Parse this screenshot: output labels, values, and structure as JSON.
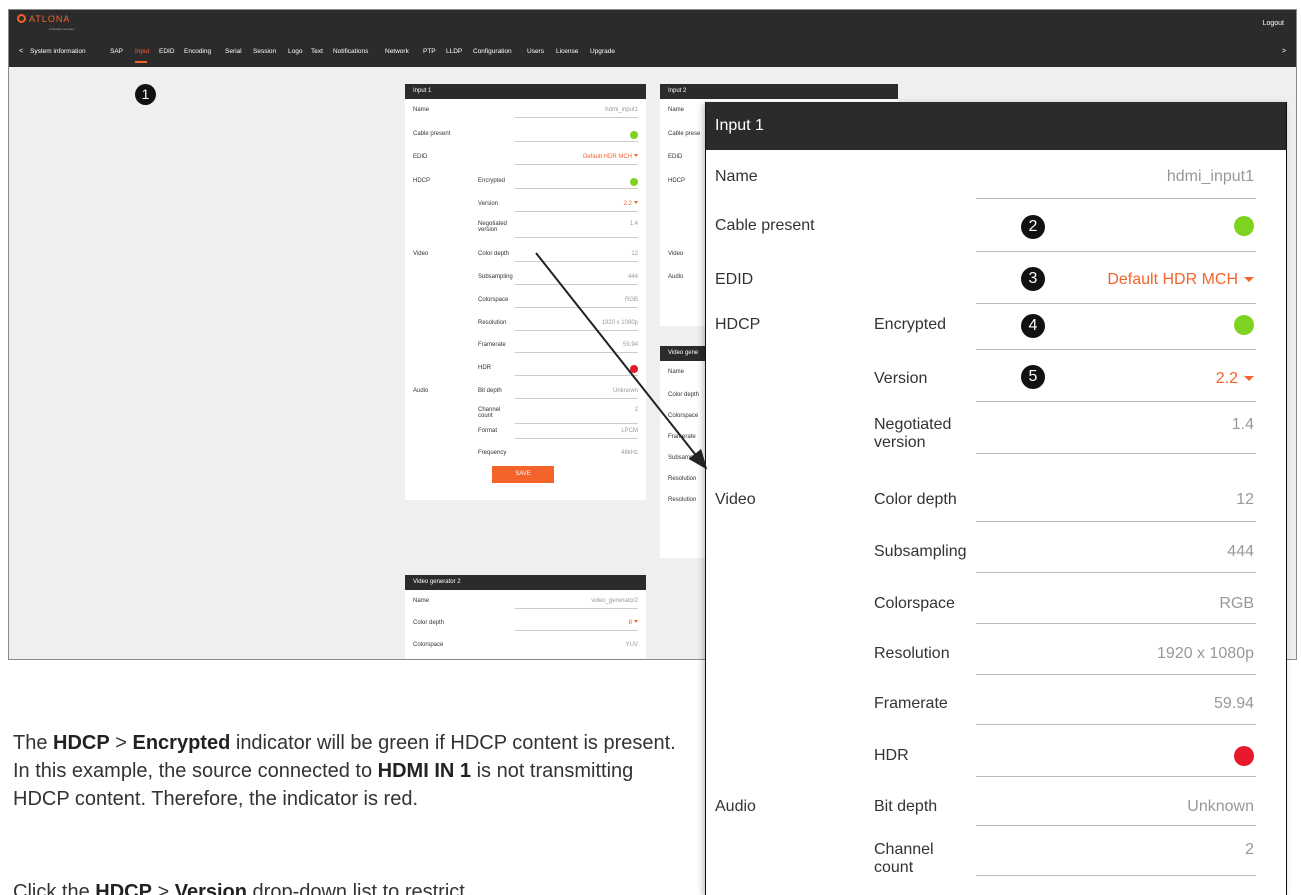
{
  "app": {
    "logo": "ATLONA",
    "logo_sub": "a Panduit company",
    "logout": "Logout",
    "nav_left": "<",
    "nav_right": ">",
    "nav_items": [
      "System information",
      "SAP",
      "Input",
      "EDID",
      "Encoding",
      "Serial",
      "Session",
      "Logo",
      "Text",
      "Notifications",
      "Network",
      "PTP",
      "LLDP",
      "Configuration",
      "Users",
      "License",
      "Upgrade"
    ],
    "active_tab": "Input",
    "marker": "1"
  },
  "input1": {
    "title": "Input 1",
    "name_label": "Name",
    "name_value": "hdmi_input1",
    "cable_label": "Cable present",
    "edid_label": "EDID",
    "edid_value": "Default HDR MCH",
    "hdcp_label": "HDCP",
    "encrypted_label": "Encrypted",
    "version_label": "Version",
    "version_value": "2.2",
    "negotiated_label": "Negotiated version",
    "negotiated_value": "1.4",
    "video_label": "Video",
    "color_depth_label": "Color depth",
    "color_depth_value": "12",
    "subsampling_label": "Subsampling",
    "subsampling_value": "444",
    "colorspace_label": "Colorspace",
    "colorspace_value": "RGB",
    "resolution_label": "Resolution",
    "resolution_value": "1920 x 1080p",
    "framerate_label": "Framerate",
    "framerate_value": "59.94",
    "hdr_label": "HDR",
    "audio_label": "Audio",
    "bit_depth_label": "Bit depth",
    "bit_depth_value": "Unknown",
    "channel_label": "Channel count",
    "channel_value": "2",
    "format_label": "Format",
    "format_value": "LPCM",
    "frequency_label": "Frequency",
    "frequency_value": "48kHz",
    "save": "SAVE"
  },
  "input2": {
    "title": "Input 2",
    "rows": [
      "Name",
      "Cable prese",
      "EDID",
      "HDCP",
      "Video",
      "Audio"
    ]
  },
  "videogen": {
    "title": "Video gene",
    "rows": [
      "Name",
      "Color depth",
      "Colorspace",
      "Framerate",
      "Subsampling",
      "Resolution",
      "Resolution"
    ]
  },
  "videogen2": {
    "title": "Video generator 2",
    "name_label": "Name",
    "name_value": "video_generator2",
    "color_depth_label": "Color depth",
    "color_depth_value": "8",
    "colorspace_label": "Colorspace",
    "colorspace_value": "YUV"
  },
  "callouts": [
    "2",
    "3",
    "4",
    "5"
  ],
  "body": {
    "p1_a": "The ",
    "p1_b": "HDCP",
    "p1_c": " > ",
    "p1_d": "Encrypted",
    "p1_e": " indicator will be green if HDCP content is present.  In this example, the source connected to ",
    "p1_f": "HDMI IN 1",
    "p1_g": " is not transmitting HDCP content.  Therefore, the indicator is red.",
    "p2_a": "Click the ",
    "p2_b": "HDCP",
    "p2_c": " > ",
    "p2_d": "Version",
    "p2_e": " drop-down list to restrict"
  },
  "colors": {
    "accent": "#f4632a",
    "header": "#2b2b2b",
    "ok": "#7ed321",
    "error": "#e8192c"
  }
}
